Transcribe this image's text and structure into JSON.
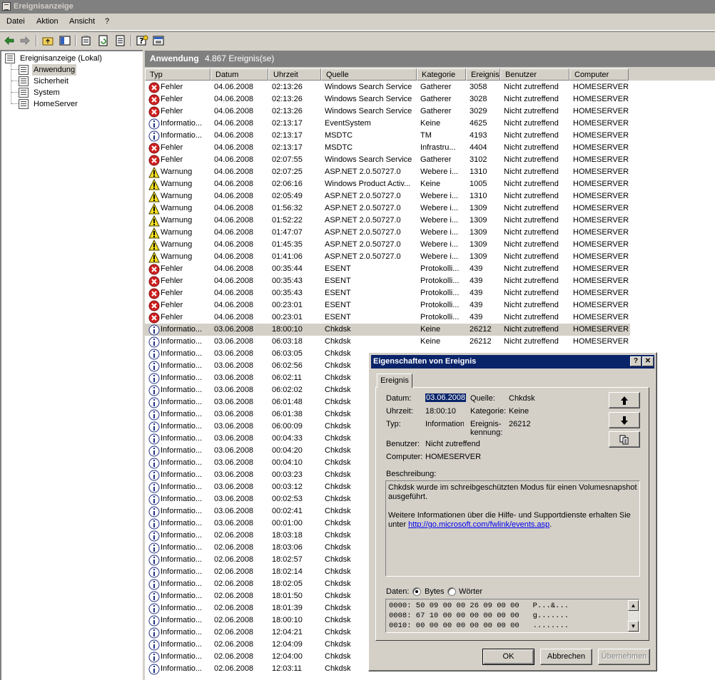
{
  "window": {
    "title": "Ereignisanzeige"
  },
  "menu": [
    {
      "pre": "D",
      "rest": "atei"
    },
    {
      "pre": "A",
      "rest": "ktion",
      "mid": "k"
    },
    {
      "pre": "A",
      "rest": "nsicht"
    },
    {
      "pre": "?",
      "rest": ""
    }
  ],
  "menu_labels": [
    "Datei",
    "Aktion",
    "Ansicht",
    "?"
  ],
  "tree": {
    "root": "Ereignisanzeige (Lokal)",
    "items": [
      "Anwendung",
      "Sicherheit",
      "System",
      "HomeServer"
    ],
    "selected": "Anwendung"
  },
  "panel": {
    "title": "Anwendung",
    "count": "4.867 Ereignis(se)"
  },
  "columns": [
    "Typ",
    "Datum",
    "Uhrzeit",
    "Quelle",
    "Kategorie",
    "Ereignis",
    "Benutzer",
    "Computer"
  ],
  "icon_types": {
    "F": "error-icon",
    "W": "warning-icon",
    "I": "info-icon"
  },
  "rows": [
    [
      "F",
      "Fehler",
      "04.06.2008",
      "02:13:26",
      "Windows Search Service",
      "Gatherer",
      "3058",
      "Nicht zutreffend",
      "HOMESERVER"
    ],
    [
      "F",
      "Fehler",
      "04.06.2008",
      "02:13:26",
      "Windows Search Service",
      "Gatherer",
      "3028",
      "Nicht zutreffend",
      "HOMESERVER"
    ],
    [
      "F",
      "Fehler",
      "04.06.2008",
      "02:13:26",
      "Windows Search Service",
      "Gatherer",
      "3029",
      "Nicht zutreffend",
      "HOMESERVER"
    ],
    [
      "I",
      "Informatio...",
      "04.06.2008",
      "02:13:17",
      "EventSystem",
      "Keine",
      "4625",
      "Nicht zutreffend",
      "HOMESERVER"
    ],
    [
      "I",
      "Informatio...",
      "04.06.2008",
      "02:13:17",
      "MSDTC",
      "TM",
      "4193",
      "Nicht zutreffend",
      "HOMESERVER"
    ],
    [
      "F",
      "Fehler",
      "04.06.2008",
      "02:13:17",
      "MSDTC",
      "Infrastru...",
      "4404",
      "Nicht zutreffend",
      "HOMESERVER"
    ],
    [
      "F",
      "Fehler",
      "04.06.2008",
      "02:07:55",
      "Windows Search Service",
      "Gatherer",
      "3102",
      "Nicht zutreffend",
      "HOMESERVER"
    ],
    [
      "W",
      "Warnung",
      "04.06.2008",
      "02:07:25",
      "ASP.NET 2.0.50727.0",
      "Webere i...",
      "1310",
      "Nicht zutreffend",
      "HOMESERVER"
    ],
    [
      "W",
      "Warnung",
      "04.06.2008",
      "02:06:16",
      "Windows Product Activ...",
      "Keine",
      "1005",
      "Nicht zutreffend",
      "HOMESERVER"
    ],
    [
      "W",
      "Warnung",
      "04.06.2008",
      "02:05:49",
      "ASP.NET 2.0.50727.0",
      "Webere i...",
      "1310",
      "Nicht zutreffend",
      "HOMESERVER"
    ],
    [
      "W",
      "Warnung",
      "04.06.2008",
      "01:56:32",
      "ASP.NET 2.0.50727.0",
      "Webere i...",
      "1309",
      "Nicht zutreffend",
      "HOMESERVER"
    ],
    [
      "W",
      "Warnung",
      "04.06.2008",
      "01:52:22",
      "ASP.NET 2.0.50727.0",
      "Webere i...",
      "1309",
      "Nicht zutreffend",
      "HOMESERVER"
    ],
    [
      "W",
      "Warnung",
      "04.06.2008",
      "01:47:07",
      "ASP.NET 2.0.50727.0",
      "Webere i...",
      "1309",
      "Nicht zutreffend",
      "HOMESERVER"
    ],
    [
      "W",
      "Warnung",
      "04.06.2008",
      "01:45:35",
      "ASP.NET 2.0.50727.0",
      "Webere i...",
      "1309",
      "Nicht zutreffend",
      "HOMESERVER"
    ],
    [
      "W",
      "Warnung",
      "04.06.2008",
      "01:41:06",
      "ASP.NET 2.0.50727.0",
      "Webere i...",
      "1309",
      "Nicht zutreffend",
      "HOMESERVER"
    ],
    [
      "F",
      "Fehler",
      "04.06.2008",
      "00:35:44",
      "ESENT",
      "Protokolli...",
      "439",
      "Nicht zutreffend",
      "HOMESERVER"
    ],
    [
      "F",
      "Fehler",
      "04.06.2008",
      "00:35:43",
      "ESENT",
      "Protokolli...",
      "439",
      "Nicht zutreffend",
      "HOMESERVER"
    ],
    [
      "F",
      "Fehler",
      "04.06.2008",
      "00:35:43",
      "ESENT",
      "Protokolli...",
      "439",
      "Nicht zutreffend",
      "HOMESERVER"
    ],
    [
      "F",
      "Fehler",
      "04.06.2008",
      "00:23:01",
      "ESENT",
      "Protokolli...",
      "439",
      "Nicht zutreffend",
      "HOMESERVER"
    ],
    [
      "F",
      "Fehler",
      "04.06.2008",
      "00:23:01",
      "ESENT",
      "Protokolli...",
      "439",
      "Nicht zutreffend",
      "HOMESERVER"
    ],
    [
      "I",
      "Informatio...",
      "03.06.2008",
      "18:00:10",
      "Chkdsk",
      "Keine",
      "26212",
      "Nicht zutreffend",
      "HOMESERVER"
    ],
    [
      "I",
      "Informatio...",
      "03.06.2008",
      "06:03:18",
      "Chkdsk",
      "Keine",
      "26212",
      "Nicht zutreffend",
      "HOMESERVER"
    ],
    [
      "I",
      "Informatio...",
      "03.06.2008",
      "06:03:05",
      "Chkdsk",
      "",
      "",
      "",
      ""
    ],
    [
      "I",
      "Informatio...",
      "03.06.2008",
      "06:02:56",
      "Chkdsk",
      "",
      "",
      "",
      ""
    ],
    [
      "I",
      "Informatio...",
      "03.06.2008",
      "06:02:11",
      "Chkdsk",
      "",
      "",
      "",
      ""
    ],
    [
      "I",
      "Informatio...",
      "03.06.2008",
      "06:02:02",
      "Chkdsk",
      "",
      "",
      "",
      ""
    ],
    [
      "I",
      "Informatio...",
      "03.06.2008",
      "06:01:48",
      "Chkdsk",
      "",
      "",
      "",
      ""
    ],
    [
      "I",
      "Informatio...",
      "03.06.2008",
      "06:01:38",
      "Chkdsk",
      "",
      "",
      "",
      ""
    ],
    [
      "I",
      "Informatio...",
      "03.06.2008",
      "06:00:09",
      "Chkdsk",
      "",
      "",
      "",
      ""
    ],
    [
      "I",
      "Informatio...",
      "03.06.2008",
      "00:04:33",
      "Chkdsk",
      "",
      "",
      "",
      ""
    ],
    [
      "I",
      "Informatio...",
      "03.06.2008",
      "00:04:20",
      "Chkdsk",
      "",
      "",
      "",
      ""
    ],
    [
      "I",
      "Informatio...",
      "03.06.2008",
      "00:04:10",
      "Chkdsk",
      "",
      "",
      "",
      ""
    ],
    [
      "I",
      "Informatio...",
      "03.06.2008",
      "00:03:23",
      "Chkdsk",
      "",
      "",
      "",
      ""
    ],
    [
      "I",
      "Informatio...",
      "03.06.2008",
      "00:03:12",
      "Chkdsk",
      "",
      "",
      "",
      ""
    ],
    [
      "I",
      "Informatio...",
      "03.06.2008",
      "00:02:53",
      "Chkdsk",
      "",
      "",
      "",
      ""
    ],
    [
      "I",
      "Informatio...",
      "03.06.2008",
      "00:02:41",
      "Chkdsk",
      "",
      "",
      "",
      ""
    ],
    [
      "I",
      "Informatio...",
      "03.06.2008",
      "00:01:00",
      "Chkdsk",
      "",
      "",
      "",
      ""
    ],
    [
      "I",
      "Informatio...",
      "02.06.2008",
      "18:03:18",
      "Chkdsk",
      "",
      "",
      "",
      ""
    ],
    [
      "I",
      "Informatio...",
      "02.06.2008",
      "18:03:06",
      "Chkdsk",
      "",
      "",
      "",
      ""
    ],
    [
      "I",
      "Informatio...",
      "02.06.2008",
      "18:02:57",
      "Chkdsk",
      "",
      "",
      "",
      ""
    ],
    [
      "I",
      "Informatio...",
      "02.06.2008",
      "18:02:14",
      "Chkdsk",
      "",
      "",
      "",
      ""
    ],
    [
      "I",
      "Informatio...",
      "02.06.2008",
      "18:02:05",
      "Chkdsk",
      "",
      "",
      "",
      ""
    ],
    [
      "I",
      "Informatio...",
      "02.06.2008",
      "18:01:50",
      "Chkdsk",
      "",
      "",
      "",
      ""
    ],
    [
      "I",
      "Informatio...",
      "02.06.2008",
      "18:01:39",
      "Chkdsk",
      "",
      "",
      "",
      ""
    ],
    [
      "I",
      "Informatio...",
      "02.06.2008",
      "18:00:10",
      "Chkdsk",
      "",
      "",
      "",
      ""
    ],
    [
      "I",
      "Informatio...",
      "02.06.2008",
      "12:04:21",
      "Chkdsk",
      "",
      "",
      "",
      ""
    ],
    [
      "I",
      "Informatio...",
      "02.06.2008",
      "12:04:09",
      "Chkdsk",
      "",
      "",
      "",
      ""
    ],
    [
      "I",
      "Informatio...",
      "02.06.2008",
      "12:04:00",
      "Chkdsk",
      "",
      "",
      "",
      ""
    ],
    [
      "I",
      "Informatio...",
      "02.06.2008",
      "12:03:11",
      "Chkdsk",
      "",
      "",
      "",
      ""
    ]
  ],
  "selected_row": 20,
  "dialog": {
    "title": "Eigenschaften von Ereignis",
    "tab": "Ereignis",
    "datum_label": "Datum:",
    "datum_value": "03.06.2008",
    "uhrzeit_label": "Uhrzeit:",
    "uhrzeit_value": "18:00:10",
    "typ_label": "Typ:",
    "typ_value": "Information",
    "quelle_label": "Quelle:",
    "quelle_value": "Chkdsk",
    "kategorie_label": "Kategorie:",
    "kategorie_value": "Keine",
    "kennung_label_1": "Ereignis-",
    "kennung_label_2": "kennung:",
    "kennung_value": "26212",
    "benutzer_label": "Benutzer:",
    "benutzer_value": "Nicht zutreffend",
    "computer_label": "Computer:",
    "computer_value": "HOMESERVER",
    "beschreibung_label": "Beschreibung:",
    "desc_line1": "Chkdsk wurde im schreibgeschützten Modus für einen Volumesnapshot ausgeführt.",
    "desc_line2": "Weitere Informationen über die Hilfe- und Supportdienste erhalten Sie unter ",
    "desc_link": "http://go.microsoft.com/fwlink/events.asp",
    "desc_end": ".",
    "daten_label": "Daten:",
    "bytes_label": "Bytes",
    "woerter_label": "Wörter",
    "hex_lines": [
      "0000: 50 09 00 00 26 09 00 00   P...&...",
      "0008: 67 10 00 00 00 00 00 00   g.......",
      "0010: 00 00 00 00 00 00 00 00   ........"
    ],
    "ok": "OK",
    "cancel": "Abbrechen",
    "apply": "Übernehmen",
    "help_btn": "?",
    "close_btn": "✕"
  }
}
